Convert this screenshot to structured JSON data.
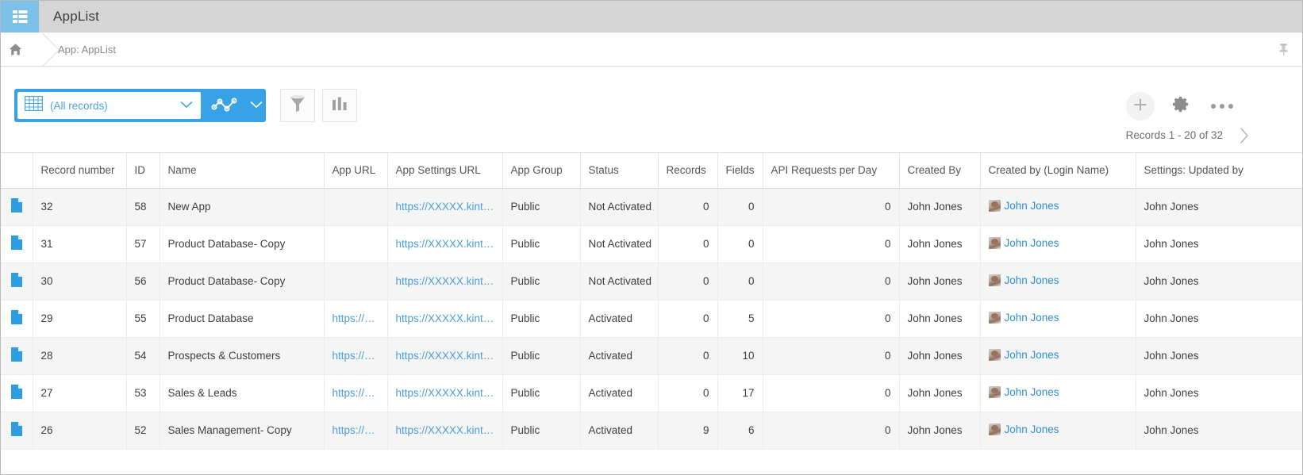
{
  "window": {
    "app_icon": "list-app-icon",
    "title": "AppList"
  },
  "breadcrumb": {
    "home_icon": "home-icon",
    "path": "App: AppList",
    "pin_icon": "pin-icon"
  },
  "toolbar": {
    "view_selector": {
      "grid_icon": "table-grid-icon",
      "value": "(All records)",
      "caret_icon": "chevron-down-icon"
    },
    "graph_button": {
      "icon": "line-graph-icon",
      "caret_icon": "chevron-down-icon"
    },
    "filter_button": {
      "icon": "funnel-filter-icon"
    },
    "chart_button": {
      "icon": "bar-chart-icon"
    },
    "add_button": {
      "icon": "plus-icon"
    },
    "settings_button": {
      "icon": "gear-icon"
    },
    "more_button": {
      "icon": "ellipsis-icon"
    }
  },
  "pagination": {
    "records_label": "Records 1 - 20 of 32",
    "next_icon": "chevron-right-icon"
  },
  "table": {
    "columns": [
      "Record number",
      "ID",
      "Name",
      "App URL",
      "App Settings URL",
      "App Group",
      "Status",
      "Records",
      "Fields",
      "API Requests per Day",
      "Created By",
      "Created by (Login Name)",
      "Settings: Updated by"
    ],
    "rows": [
      {
        "record_icon": "document-icon",
        "record_number": "32",
        "id": "58",
        "name": "New App",
        "app_url": "",
        "app_settings_url": "https://XXXXX.kint…",
        "app_group": "Public",
        "status": "Not Activated",
        "records": "0",
        "fields": "0",
        "api_requests": "0",
        "created_by": "John Jones",
        "created_by_login": "John Jones",
        "settings_updated_by": "John Jones"
      },
      {
        "record_icon": "document-icon",
        "record_number": "31",
        "id": "57",
        "name": "Product Database- Copy",
        "app_url": "",
        "app_settings_url": "https://XXXXX.kint…",
        "app_group": "Public",
        "status": "Not Activated",
        "records": "0",
        "fields": "0",
        "api_requests": "0",
        "created_by": "John Jones",
        "created_by_login": "John Jones",
        "settings_updated_by": "John Jones"
      },
      {
        "record_icon": "document-icon",
        "record_number": "30",
        "id": "56",
        "name": "Product Database- Copy",
        "app_url": "",
        "app_settings_url": "https://XXXXX.kint…",
        "app_group": "Public",
        "status": "Not Activated",
        "records": "0",
        "fields": "0",
        "api_requests": "0",
        "created_by": "John Jones",
        "created_by_login": "John Jones",
        "settings_updated_by": "John Jones"
      },
      {
        "record_icon": "document-icon",
        "record_number": "29",
        "id": "55",
        "name": "Product Database",
        "app_url": "https://…",
        "app_settings_url": "https://XXXXX.kint…",
        "app_group": "Public",
        "status": "Activated",
        "records": "0",
        "fields": "5",
        "api_requests": "0",
        "created_by": "John Jones",
        "created_by_login": "John Jones",
        "settings_updated_by": "John Jones"
      },
      {
        "record_icon": "document-icon",
        "record_number": "28",
        "id": "54",
        "name": "Prospects & Customers",
        "app_url": "https://…",
        "app_settings_url": "https://XXXXX.kint…",
        "app_group": "Public",
        "status": "Activated",
        "records": "0",
        "fields": "10",
        "api_requests": "0",
        "created_by": "John Jones",
        "created_by_login": "John Jones",
        "settings_updated_by": "John Jones"
      },
      {
        "record_icon": "document-icon",
        "record_number": "27",
        "id": "53",
        "name": "Sales & Leads",
        "app_url": "https://…",
        "app_settings_url": "https://XXXXX.kint…",
        "app_group": "Public",
        "status": "Activated",
        "records": "0",
        "fields": "17",
        "api_requests": "0",
        "created_by": "John Jones",
        "created_by_login": "John Jones",
        "settings_updated_by": "John Jones"
      },
      {
        "record_icon": "document-icon",
        "record_number": "26",
        "id": "52",
        "name": "Sales Management- Copy",
        "app_url": "https://…",
        "app_settings_url": "https://XXXXX.kint…",
        "app_group": "Public",
        "status": "Activated",
        "records": "9",
        "fields": "6",
        "api_requests": "0",
        "created_by": "John Jones",
        "created_by_login": "John Jones",
        "settings_updated_by": "John Jones"
      }
    ]
  },
  "colors": {
    "accent": "#37a3e6",
    "link": "#4a9fd8",
    "titlebar": "#d5d5d5",
    "logo": "#7dc1e8",
    "row_stripe": "#f5f5f5"
  }
}
